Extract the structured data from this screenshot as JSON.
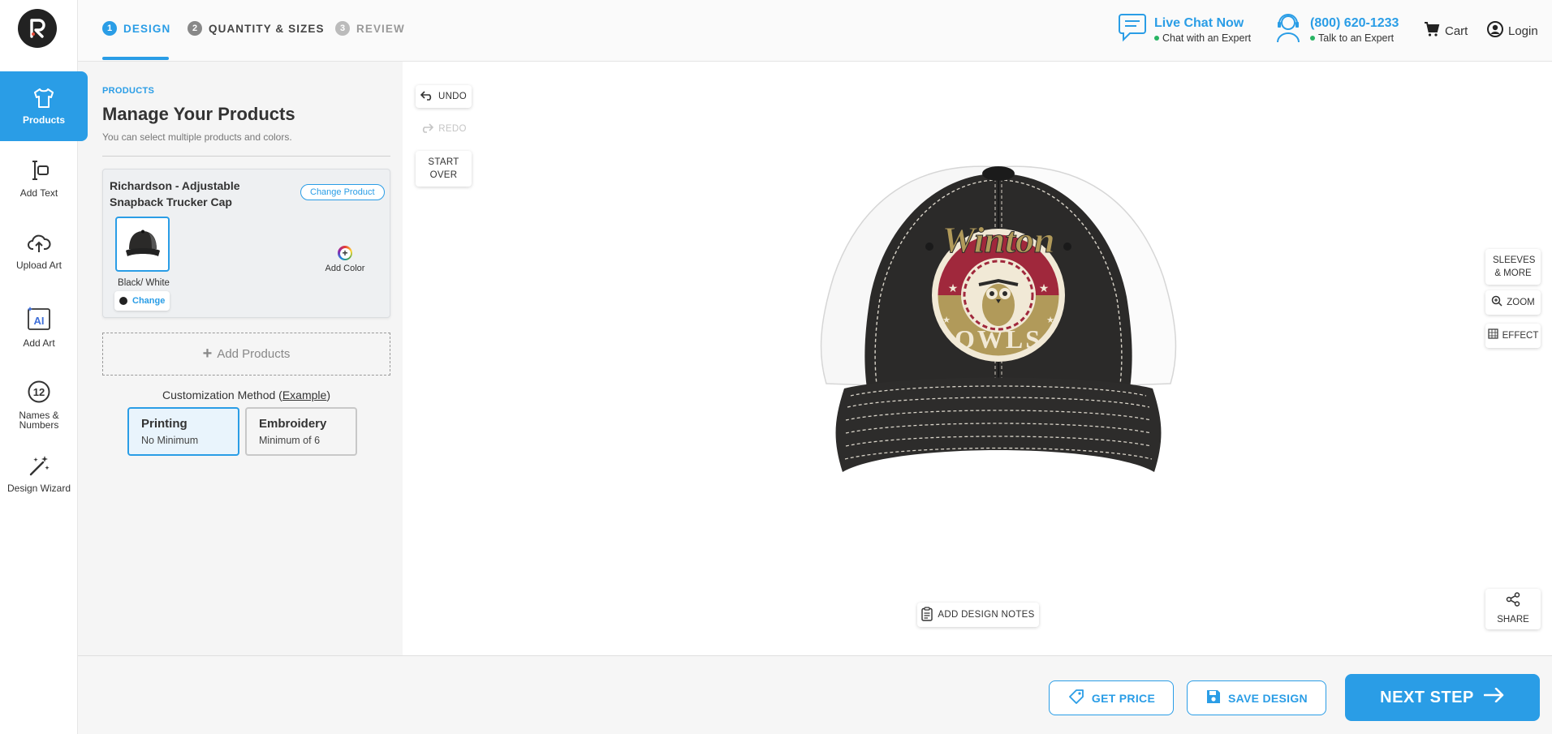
{
  "nav": {
    "items": [
      {
        "label": "Products",
        "icon": "tshirt-icon"
      },
      {
        "label": "Add Text",
        "icon": "text-cursor-icon"
      },
      {
        "label": "Upload Art",
        "icon": "cloud-upload-icon"
      },
      {
        "label": "Add Art",
        "icon": "ai-art-icon"
      },
      {
        "label": "Names &\nNumbers",
        "icon": "number-badge-icon"
      },
      {
        "label": "Design Wizard",
        "icon": "magic-wand-icon"
      }
    ],
    "logo_letter": "R"
  },
  "steps": [
    {
      "num": "1",
      "label": "DESIGN"
    },
    {
      "num": "2",
      "label": "QUANTITY & SIZES"
    },
    {
      "num": "3",
      "label": "REVIEW"
    }
  ],
  "header": {
    "chat_title": "Live Chat Now",
    "chat_sub": "Chat with an Expert",
    "phone": "(800) 620-1233",
    "phone_sub": "Talk to an Expert",
    "cart": "Cart",
    "login": "Login"
  },
  "panel": {
    "eyebrow": "PRODUCTS",
    "title": "Manage Your Products",
    "subtitle": "You can select multiple products and colors.",
    "product": {
      "name": "Richardson - Adjustable Snapback Trucker Cap",
      "change_product": "Change Product",
      "color_name": "Black/ White",
      "change_color": "Change",
      "add_color": "Add Color"
    },
    "add_products": "Add Products",
    "customization_label": "Customization Method (",
    "customization_link": "Example",
    "customization_close": ")",
    "methods": [
      {
        "title": "Printing",
        "sub": "No Minimum"
      },
      {
        "title": "Embroidery",
        "sub": "Minimum of 6"
      }
    ]
  },
  "canvas": {
    "undo": "UNDO",
    "redo": "REDO",
    "start_over": "START OVER",
    "sleeves": "SLEEVES & MORE",
    "zoom": "ZOOM",
    "effect": "EFFECT",
    "notes": "ADD DESIGN NOTES",
    "share": "SHARE",
    "logo_top": "Winton",
    "logo_bottom": "OWLS"
  },
  "footer": {
    "get_price": "GET PRICE",
    "save_design": "SAVE DESIGN",
    "next_step": "NEXT STEP"
  },
  "colors": {
    "accent": "#2a9de6",
    "cap_black": "#2b2a29",
    "logo_red": "#a0283c",
    "logo_gold": "#b19a5a"
  }
}
